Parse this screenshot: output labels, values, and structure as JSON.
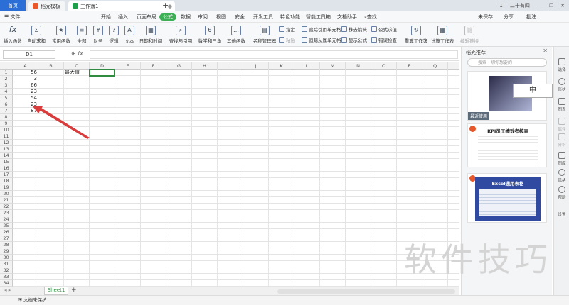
{
  "tabs": {
    "home": "首页",
    "template": "稻壳模板",
    "workbook": "工作簿1",
    "add": "+"
  },
  "window": {
    "sync": "1",
    "user": "二十有四",
    "minimize": "—",
    "restore": "❐",
    "close": "✕"
  },
  "menu": {
    "file": "☰ 文件",
    "items": [
      "开始",
      "插入",
      "页面布局",
      "公式",
      "数据",
      "审阅",
      "视图",
      "安全",
      "开发工具",
      "特色功能",
      "智能工具箱",
      "文档助手"
    ],
    "active_index": 3,
    "search": "查找",
    "right": [
      "未保存",
      "分享",
      "批注"
    ]
  },
  "ribbon": {
    "large": [
      "插入函数",
      "自动求和",
      "常用函数",
      "全部",
      "财务",
      "逻辑",
      "文本",
      "日期和时间",
      "查找与引用",
      "数学和三角",
      "其他函数",
      "名称管理器"
    ],
    "small_col1": [
      "指定",
      "粘贴"
    ],
    "small_col2": [
      "追踪引用单元格",
      "追踪从属单元格"
    ],
    "small_col3": [
      "移去箭头",
      "显示公式"
    ],
    "small_col4": [
      "公式求值",
      "错误检查"
    ],
    "large_right": [
      "重算工作簿",
      "计算工作表",
      "编辑链接"
    ]
  },
  "formula": {
    "namebox": "D1",
    "fx": "fx",
    "value": ""
  },
  "columns": [
    "A",
    "B",
    "C",
    "D",
    "E",
    "F",
    "G",
    "H",
    "I",
    "J",
    "K",
    "L",
    "M",
    "N",
    "O",
    "P",
    "Q",
    "R"
  ],
  "rows": [
    "1",
    "2",
    "3",
    "4",
    "5",
    "6",
    "7",
    "8",
    "9",
    "10",
    "11",
    "12",
    "13",
    "14",
    "15",
    "16",
    "17",
    "18",
    "19",
    "20",
    "21",
    "22",
    "23",
    "24",
    "25",
    "26",
    "27",
    "28",
    "29",
    "30",
    "31",
    "32",
    "33",
    "34"
  ],
  "cells": {
    "A1": "56",
    "A2": "3",
    "A3": "66",
    "A4": "23",
    "A5": "54",
    "A6": "23",
    "A7": "87",
    "C1": "最大值"
  },
  "selected_cell": "D1",
  "sheet": {
    "name": "Sheet1",
    "add": "+"
  },
  "status": {
    "protect": "文档未保护"
  },
  "panel": {
    "title": "稻壳推荐",
    "search_placeholder": "搜索一切你想要的",
    "recent_label": "最近使用",
    "card2_title": "KPI员工绩效考核表",
    "card3_title": "Excel通用表格",
    "floating_label": "中"
  },
  "rail": [
    "选择",
    "形状",
    "图表",
    "属性",
    "分析",
    "图库",
    "风格",
    "帮助",
    "设置"
  ],
  "watermark": "软件技巧",
  "colors": {
    "accent_green": "#3cae54",
    "home_blue": "#2b6fd6",
    "arrow_red": "#d93c3c"
  }
}
